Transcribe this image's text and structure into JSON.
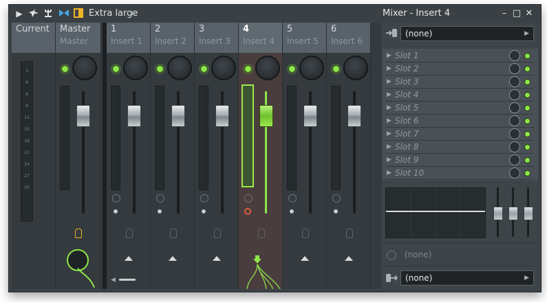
{
  "toolbar": {
    "size_label": "Extra large",
    "icons": [
      "play-arrow-icon",
      "bird-icon",
      "pitchfork-icon",
      "bowtie-icon",
      "panel-toggle-icon",
      "menu-arrow-icon"
    ]
  },
  "panel_window": {
    "title": "Mixer - Insert 4",
    "buttons": [
      "minimize",
      "maximize",
      "close"
    ]
  },
  "strips": [
    {
      "number": "Current",
      "name": ""
    },
    {
      "number": "Master",
      "name": "Master"
    },
    {
      "number": "1",
      "name": "Insert 1"
    },
    {
      "number": "2",
      "name": "Insert 2"
    },
    {
      "number": "3",
      "name": "Insert 3"
    },
    {
      "number": "4",
      "name": "Insert 4"
    },
    {
      "number": "5",
      "name": "Insert 5"
    },
    {
      "number": "6",
      "name": "Insert 6"
    }
  ],
  "meter_scale": [
    "3",
    "6",
    "6",
    "9",
    "12",
    "15",
    "18",
    "21",
    "24",
    "27",
    "30"
  ],
  "insert_panel": {
    "input_label": "(none)",
    "slots": [
      "Slot 1",
      "Slot 2",
      "Slot 3",
      "Slot 4",
      "Slot 5",
      "Slot 6",
      "Slot 7",
      "Slot 8",
      "Slot 9",
      "Slot 10"
    ],
    "output_time_label": "(none)",
    "output_label": "(none)"
  },
  "colors": {
    "accent_green": "#8ee64a",
    "selected_strip": "#4a3d3d",
    "panel_bg": "#3e4549"
  }
}
